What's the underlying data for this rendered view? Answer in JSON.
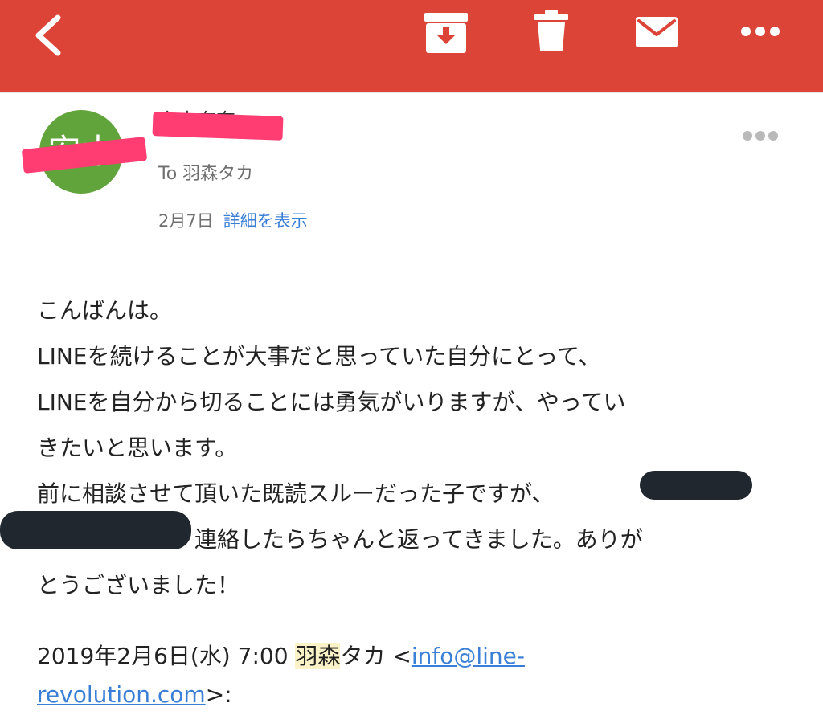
{
  "toolbar": {
    "background": "#dc4437",
    "icons": {
      "back": "chevron-left-icon",
      "archive": "archive-icon",
      "delete": "trash-icon",
      "mark_unread": "envelope-icon",
      "more": "more-horizontal-icon"
    }
  },
  "message": {
    "sender_name": "安木奈奈",
    "avatar_initials": "安木",
    "avatar_color": "#62a43c",
    "recipient": "To 羽森タカ",
    "date": "2月7日",
    "details_link": "詳細を表示",
    "body": {
      "line1": "こんばんは。",
      "line2": "LINEを続けることが大事だと思っていた自分にとって、",
      "line3": "LINEを自分から切ることには勇気がいりますが、やってい",
      "line4": "きたいと思います。",
      "line5": "前に相談させて頂いた既読スルーだった子ですが、",
      "line6": "連絡したらちゃんと返ってきました。ありが",
      "line7": "とうございました！"
    },
    "quote": {
      "date_prefix": "2019年2月6日(水) 7:00",
      "name": "羽森",
      "name_rest": "タカ",
      "email_open": "<",
      "email_part1": "info@line-",
      "email_part2": "revolution.com",
      "email_close": ">:"
    }
  }
}
